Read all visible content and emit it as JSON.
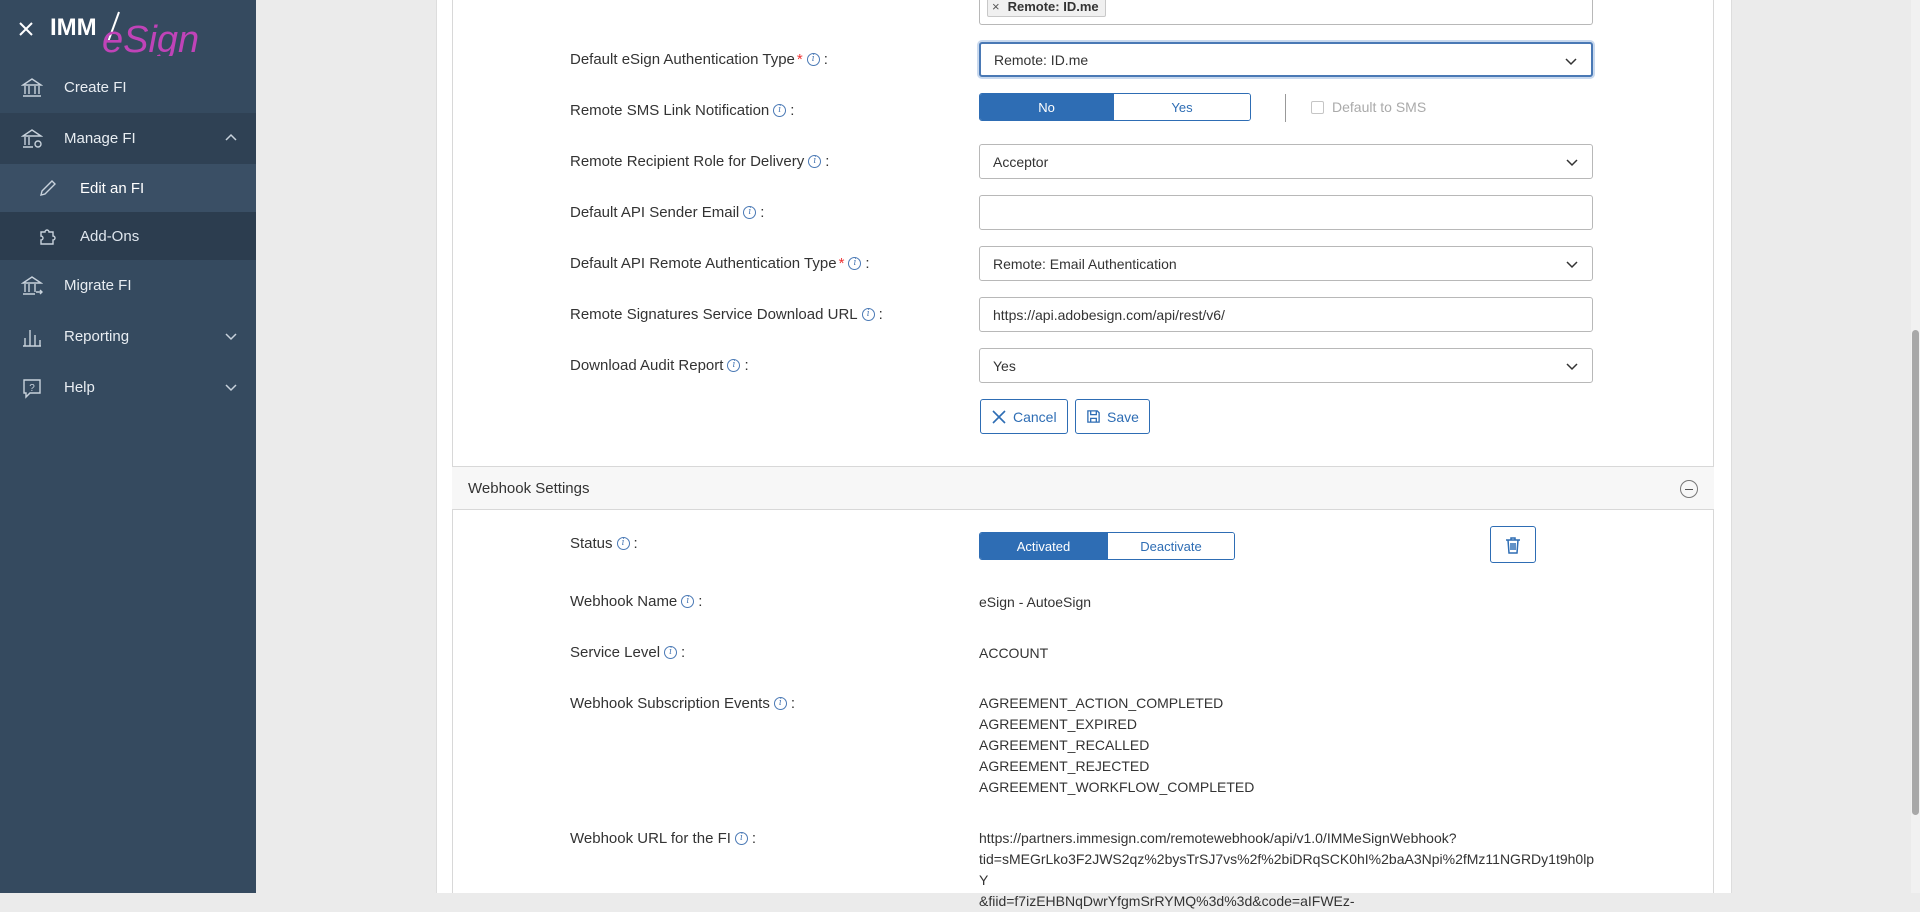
{
  "sidebar": {
    "logo_text_1": "IMM",
    "logo_text_2": "eSign",
    "items": {
      "create": "Create FI",
      "manage": "Manage FI",
      "edit": "Edit an FI",
      "addons": "Add-Ons",
      "migrate": "Migrate FI",
      "reporting": "Reporting",
      "help": "Help"
    }
  },
  "form": {
    "auth_types_tag": "Remote: ID.me",
    "default_auth": {
      "label": "Default eSign Authentication Type",
      "value": "Remote: ID.me"
    },
    "sms_notification": {
      "label": "Remote SMS Link Notification",
      "no": "No",
      "yes": "Yes",
      "default_sms": "Default to SMS"
    },
    "recipient_role": {
      "label": "Remote Recipient Role for Delivery",
      "value": "Acceptor"
    },
    "sender_email": {
      "label": "Default API Sender Email",
      "value": ""
    },
    "api_auth": {
      "label": "Default API Remote Authentication Type",
      "value": "Remote: Email Authentication"
    },
    "download_url": {
      "label": "Remote Signatures Service Download URL",
      "value": "https://api.adobesign.com/api/rest/v6/"
    },
    "audit_report": {
      "label": "Download Audit Report",
      "value": "Yes"
    },
    "cancel": "Cancel",
    "save": "Save"
  },
  "webhook": {
    "title": "Webhook Settings",
    "status": {
      "label": "Status",
      "activated": "Activated",
      "deactivate": "Deactivate"
    },
    "name": {
      "label": "Webhook Name",
      "value": "eSign - AutoeSign"
    },
    "service_level": {
      "label": "Service Level",
      "value": "ACCOUNT"
    },
    "events": {
      "label": "Webhook Subscription Events",
      "list": [
        "AGREEMENT_ACTION_COMPLETED",
        "AGREEMENT_EXPIRED",
        "AGREEMENT_RECALLED",
        "AGREEMENT_REJECTED",
        "AGREEMENT_WORKFLOW_COMPLETED"
      ]
    },
    "url": {
      "label": "Webhook URL for the FI",
      "line1": "https://partners.immesign.com/remotewebhook/api/v1.0/IMMeSignWebhook?",
      "line2": "tid=sMEGrLko3F2JWS2qz%2bysTrSJ7vs%2f%2biDRqSCK0hI%2baA3Npi%2fMz11NGRDy1t9h0lpY",
      "line3": "&fiid=f7izEHBNqDwrYfgmSrRYMQ%3d%3d&code=aIFWEz-"
    }
  }
}
